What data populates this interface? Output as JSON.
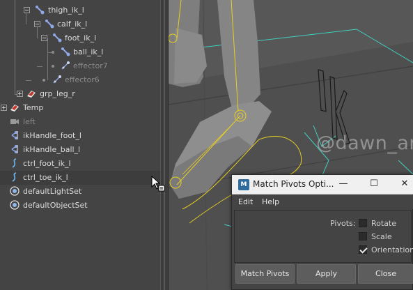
{
  "outliner": {
    "items": [
      {
        "label": "thigh_ik_l",
        "type": "joint"
      },
      {
        "label": "calf_ik_l",
        "type": "joint"
      },
      {
        "label": "foot_ik_l",
        "type": "joint"
      },
      {
        "label": "ball_ik_l",
        "type": "joint"
      },
      {
        "label": "effector7",
        "type": "effector"
      },
      {
        "label": "effector6",
        "type": "effector"
      },
      {
        "label": "grp_leg_r",
        "type": "group"
      },
      {
        "label": "Temp",
        "type": "group"
      },
      {
        "label": "left",
        "type": "camera"
      },
      {
        "label": "ikHandle_foot_l",
        "type": "ikHandle"
      },
      {
        "label": "ikHandle_ball_l",
        "type": "ikHandle"
      },
      {
        "label": "ctrl_foot_ik_l",
        "type": "curve"
      },
      {
        "label": "ctrl_toe_ik_l",
        "type": "curve"
      },
      {
        "label": "defaultLightSet",
        "type": "set"
      },
      {
        "label": "defaultObjectSet",
        "type": "set"
      }
    ]
  },
  "viewport": {
    "watermark": "@dawn_arc"
  },
  "dialog": {
    "app_icon": "M",
    "title": "Match Pivots Opti...",
    "window_buttons": {
      "minimize": "—",
      "maximize": "☐",
      "close": "✕"
    },
    "menu": [
      "Edit",
      "Help"
    ],
    "pivots_label": "Pivots:",
    "options": [
      {
        "label": "Rotate",
        "checked": false
      },
      {
        "label": "Scale",
        "checked": false
      },
      {
        "label": "Orientation",
        "checked": true
      }
    ],
    "buttons": [
      "Match Pivots",
      "Apply",
      "Close"
    ]
  },
  "colors": {
    "outliner_bg": "#444444",
    "viewport_bg": "#575757",
    "joint_icon": "#8fa8e8",
    "curve_icon": "#6ab0e6",
    "wire_yellow": "#e8d020",
    "grid_cyan": "#3fd0c0"
  }
}
